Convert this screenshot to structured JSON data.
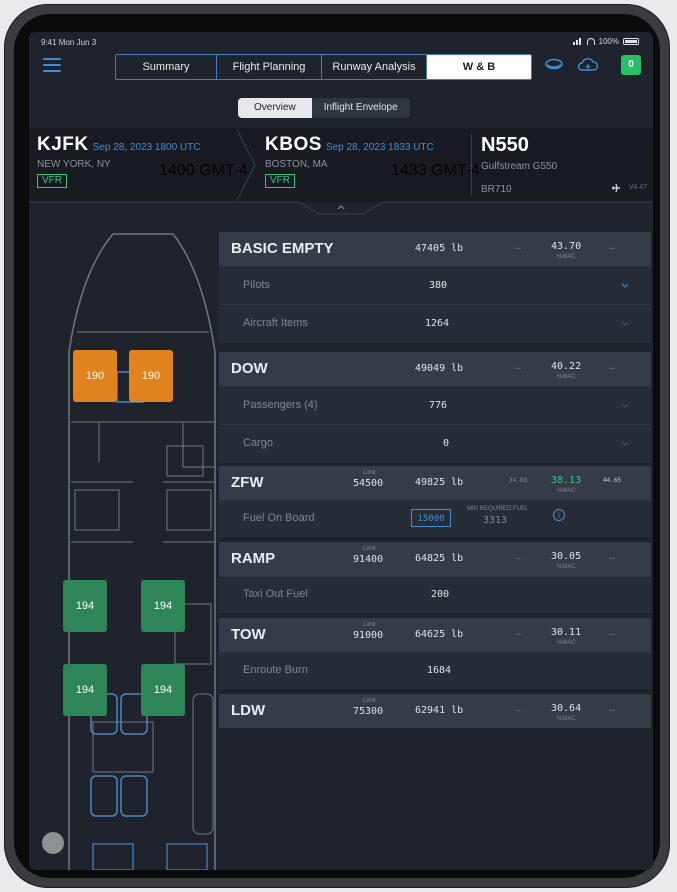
{
  "status": {
    "time": "9:41 Mon Jun 3",
    "battery": "100%"
  },
  "tabs": [
    "Summary",
    "Flight Planning",
    "Runway Analysis",
    "W & B"
  ],
  "badge_count": "0",
  "subtabs": [
    "Overview",
    "Inflight Envelope"
  ],
  "departure": {
    "code": "KJFK",
    "date": "Sep 28, 2023 1800 UTC",
    "city": "NEW YORK, NY",
    "gmt": "1400 GMT-4",
    "rules": "VFR"
  },
  "arrival": {
    "code": "KBOS",
    "date": "Sep 28, 2023 1833 UTC",
    "city": "BOSTON, MA",
    "gmt": "1433 GMT-4",
    "rules": "VFR"
  },
  "aircraft": {
    "tail": "N550",
    "type": "Gulfstream G550",
    "engine": "BR710",
    "version": "V4.47"
  },
  "seats": {
    "crew": [
      "190",
      "190"
    ],
    "pax": [
      "194",
      "194",
      "194",
      "194"
    ]
  },
  "wb": {
    "mac_label": "%MAC",
    "limit_label": "Limit",
    "sections": [
      {
        "label": "BASIC EMPTY",
        "limit": "",
        "weight": "47405 lb",
        "dash1": "--",
        "mac": "43.70",
        "dash2": "--",
        "rows": [
          {
            "label": "Pilots",
            "value": "380"
          },
          {
            "label": "Aircraft Items",
            "value": "1264"
          }
        ]
      },
      {
        "label": "DOW",
        "limit": "",
        "weight": "49049 lb",
        "dash1": "--",
        "mac": "40.22",
        "dash2": "--",
        "rows": [
          {
            "label": "Passengers (4)",
            "value": "776"
          },
          {
            "label": "Cargo",
            "value": "0"
          }
        ]
      },
      {
        "label": "ZFW",
        "limit": "54500",
        "weight": "49825 lb",
        "dash1": "34.68",
        "mac": "38.13",
        "dash2": "44.65",
        "fuel": {
          "label": "Fuel On Board",
          "value": "15000",
          "min_label": "MIN REQUIRED FUEL",
          "min_value": "3313"
        }
      },
      {
        "label": "RAMP",
        "limit": "91400",
        "weight": "64825 lb",
        "dash1": "--",
        "mac": "30.05",
        "dash2": "--",
        "rows": [
          {
            "label": "Taxi Out Fuel",
            "value": "200"
          }
        ]
      },
      {
        "label": "TOW",
        "limit": "91000",
        "weight": "64625 lb",
        "dash1": "--",
        "mac": "30.11",
        "dash2": "--",
        "rows": [
          {
            "label": "Enroute Burn",
            "value": "1684"
          }
        ]
      },
      {
        "label": "LDW",
        "limit": "75300",
        "weight": "62941 lb",
        "dash1": "--",
        "mac": "30.64",
        "dash2": "--"
      }
    ]
  },
  "colors": {
    "accent": "#3f8fd6",
    "crew_seat": "#e0821e",
    "pax_seat": "#2e8557",
    "in_limits": "#3cc37a",
    "panel": "#353c47"
  }
}
